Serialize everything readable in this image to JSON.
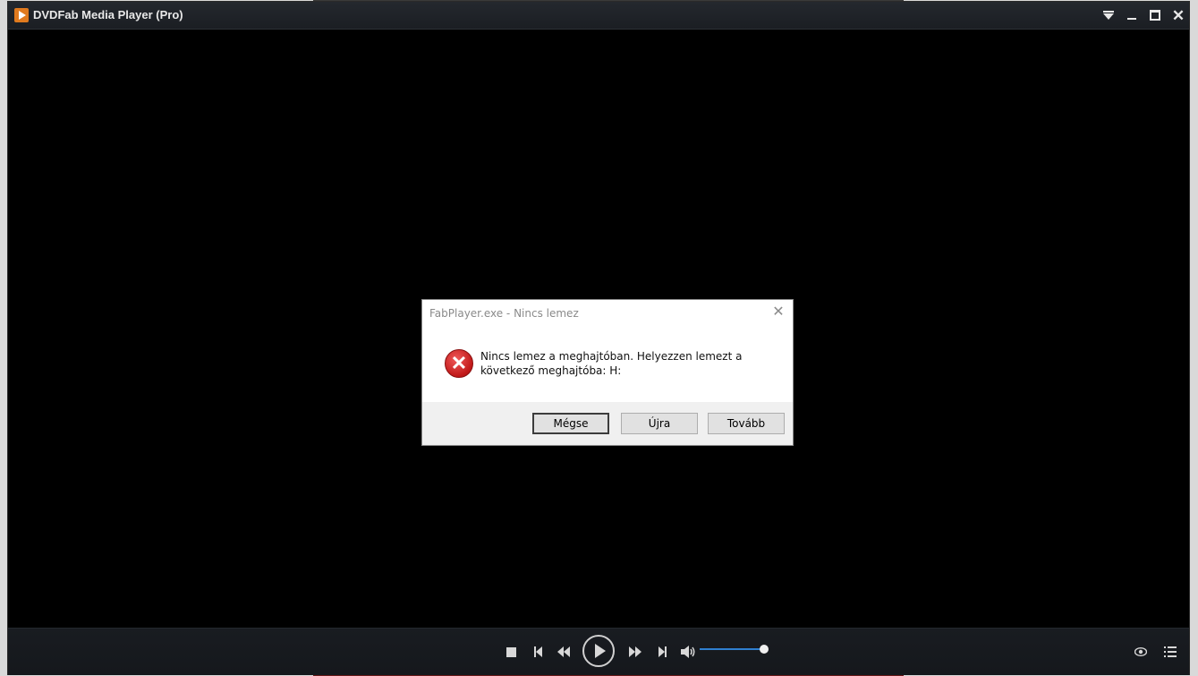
{
  "window": {
    "title": "DVDFab Media Player (Pro)",
    "controls": [
      "dropdown-icon",
      "minimize-icon",
      "maximize-icon",
      "close-icon"
    ]
  },
  "dialog": {
    "title": "FabPlayer.exe - Nincs lemez",
    "message": "Nincs lemez a meghajtóban. Helyezzen lemezt a következő meghajtóba: H:",
    "icon": "error-icon",
    "buttons": {
      "cancel": "Mégse",
      "retry": "Újra",
      "continue": "Tovább"
    }
  },
  "controls": {
    "icons": [
      "stop-icon",
      "previous-icon",
      "rewind-icon",
      "play-icon",
      "fast-forward-icon",
      "next-icon",
      "volume-icon",
      "eye-icon",
      "playlist-icon"
    ],
    "volume_level": 1.0
  },
  "colors": {
    "accent": "#2f7fd0",
    "logo": "#e07a1e",
    "error": "#c01818"
  }
}
